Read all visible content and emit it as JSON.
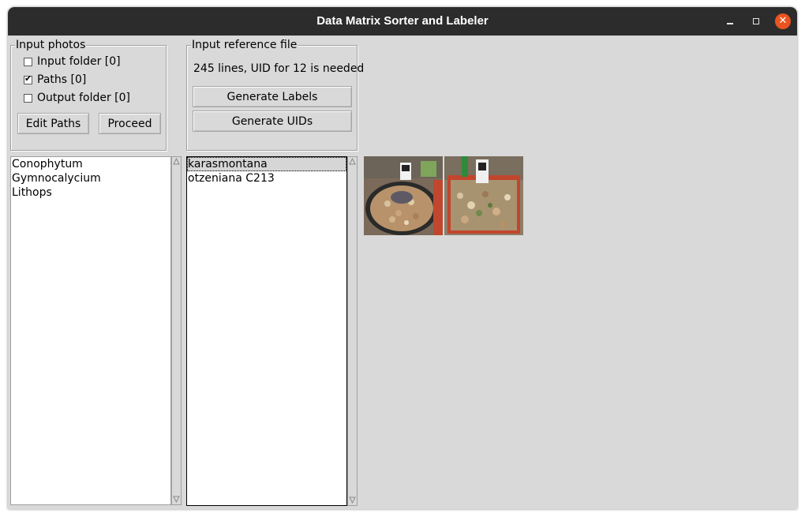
{
  "window": {
    "title": "Data Matrix Sorter and Labeler",
    "controls": {
      "minimize": "minimize-icon",
      "maximize": "maximize-icon",
      "close": "close-icon"
    }
  },
  "input_photos": {
    "legend": "Input photos",
    "checkboxes": [
      {
        "label": "Input folder [0]",
        "checked": false
      },
      {
        "label": "Paths [0]",
        "checked": true
      },
      {
        "label": "Output folder [0]",
        "checked": false
      }
    ],
    "edit_paths_label": "Edit Paths",
    "proceed_label": "Proceed"
  },
  "input_reference": {
    "legend": "Input reference file",
    "status": "245 lines, UID for 12 is needed",
    "generate_labels_label": "Generate Labels",
    "generate_uids_label": "Generate UIDs"
  },
  "genus_list": {
    "items": [
      "Conophytum",
      "Gymnocalycium",
      "Lithops"
    ]
  },
  "species_list": {
    "items": [
      "karasmontana",
      "otzeniana C213"
    ],
    "selected_index": 0
  },
  "thumbnails": [
    {
      "name": "photo-thumbnail-1",
      "icon": "plant-pot-photo"
    },
    {
      "name": "photo-thumbnail-2",
      "icon": "plant-pots-photo"
    }
  ],
  "colors": {
    "titlebar": "#2c2c2c",
    "window_bg": "#d9d9d9",
    "close_button": "#e95420"
  }
}
